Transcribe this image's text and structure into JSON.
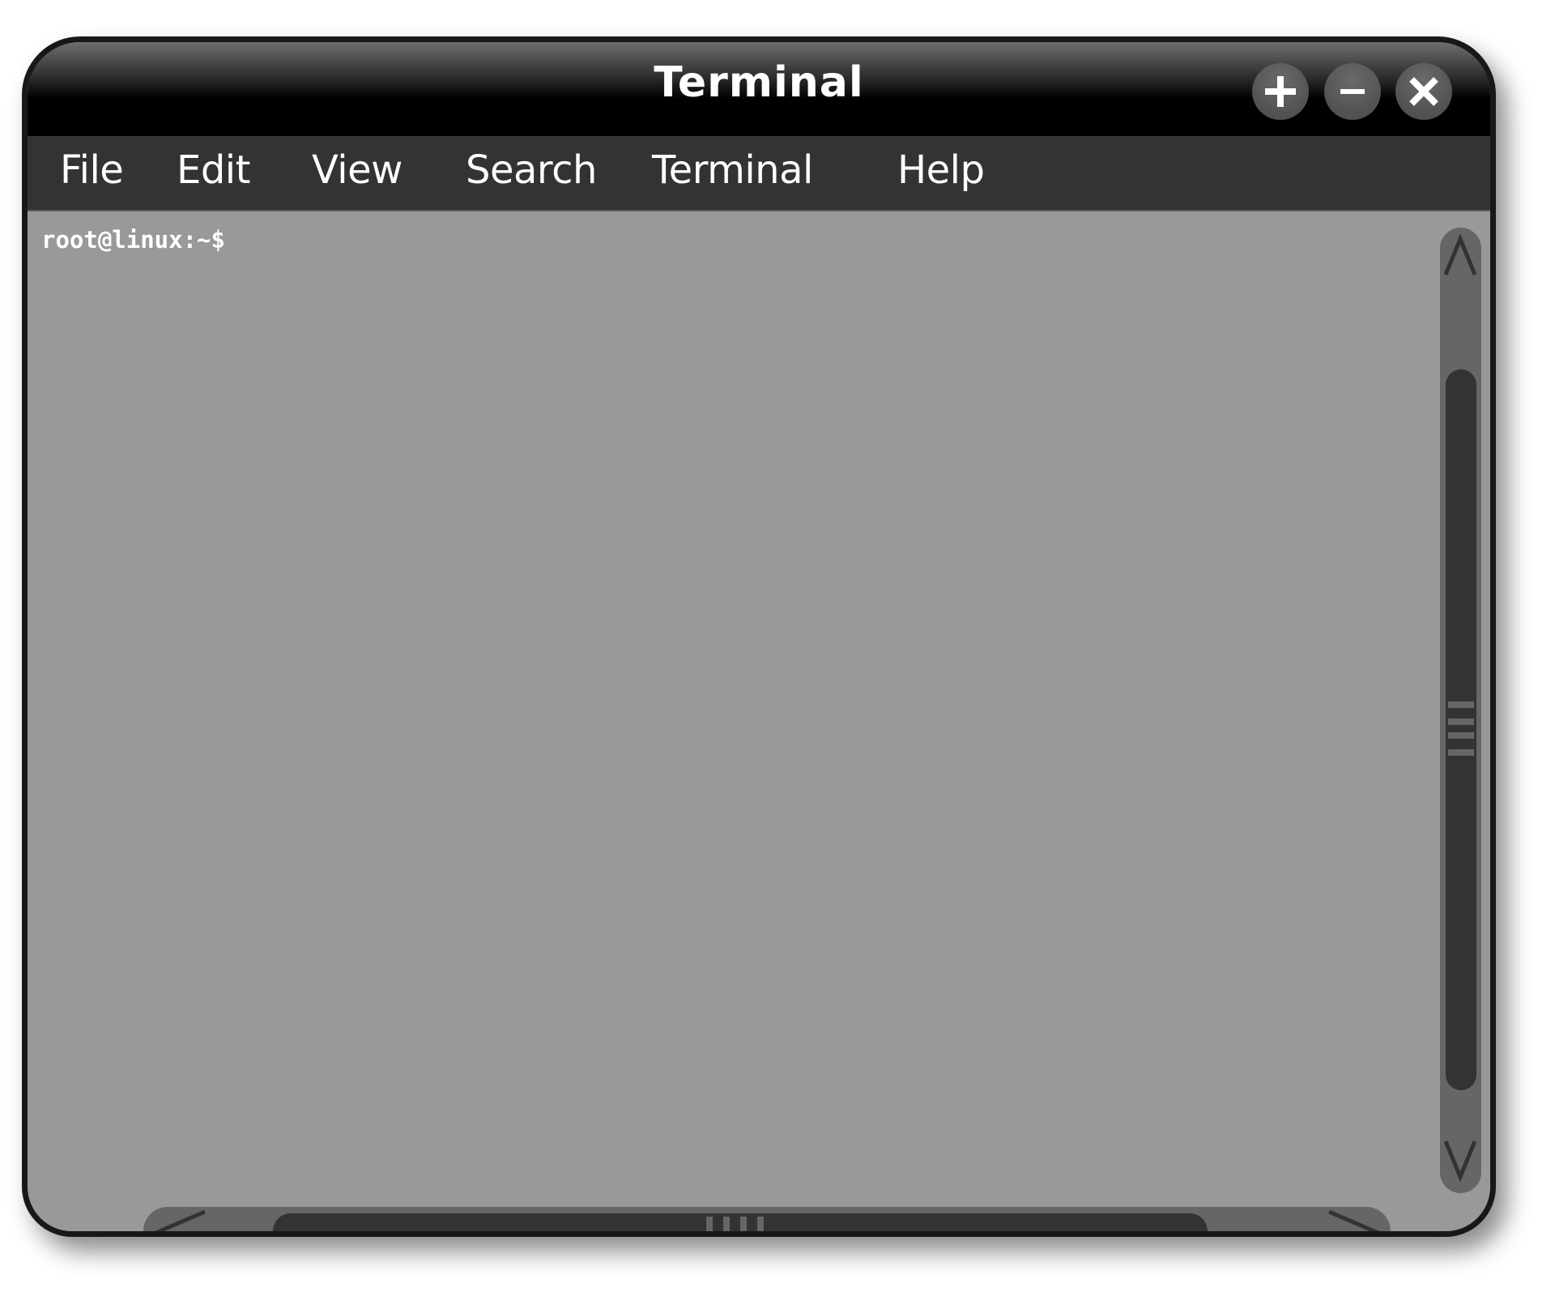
{
  "window": {
    "title": "Terminal",
    "controls": [
      {
        "name": "maximize",
        "icon": "plus-icon"
      },
      {
        "name": "minimize",
        "icon": "minus-icon"
      },
      {
        "name": "close",
        "icon": "close-icon"
      }
    ]
  },
  "menubar": {
    "items": [
      {
        "label": "File"
      },
      {
        "label": "Edit"
      },
      {
        "label": "View"
      },
      {
        "label": "Search"
      },
      {
        "label": "Terminal"
      },
      {
        "label": "Help"
      }
    ]
  },
  "terminal": {
    "prompt": "root@linux:~$",
    "input": ""
  },
  "scrollbars": {
    "vertical": {
      "up_icon": "chevron-up-icon",
      "down_icon": "chevron-down-icon"
    },
    "horizontal": {
      "left_icon": "chevron-left-icon",
      "right_icon": "chevron-right-icon"
    }
  },
  "colors": {
    "titlebar": "#000000",
    "menubar": "#333333",
    "content": "#999999",
    "scroll_track": "#666666",
    "scroll_thumb": "#333333",
    "border": "#181818"
  }
}
